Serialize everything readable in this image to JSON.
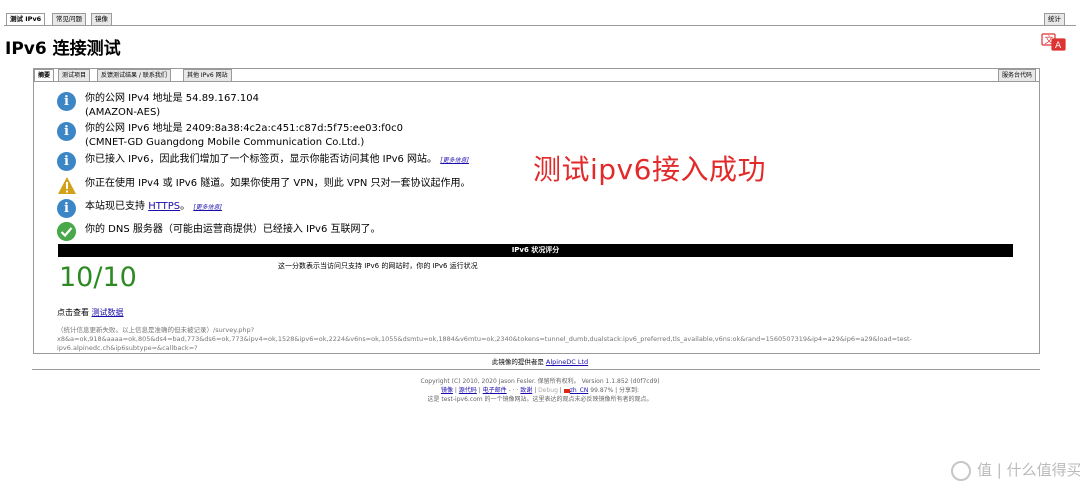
{
  "top_tabs": {
    "test": "测试 IPv6",
    "faq": "常见问题",
    "mirrors": "镜像",
    "stats": "统计"
  },
  "page_title": "IPv6 连接测试",
  "sub_tabs": {
    "summary": "摘要",
    "tests": "测试项目",
    "feedback": "反馈测试结果 / 联系我们",
    "other_sites": "其他 IPv6 网站",
    "helpdesk": "服务台代码"
  },
  "results": [
    {
      "line1": "你的公网 IPv4 地址是 54.89.167.104",
      "line2": "(AMAZON-AES)"
    },
    {
      "line1": "你的公网 IPv6 地址是 2409:8a38:4c2a:c451:c87d:5f75:ee03:f0c0",
      "line2": "(CMNET-GD Guangdong Mobile Communication Co.Ltd.)"
    },
    {
      "line1": "你已接入 IPv6，因此我们增加了一个标签页，显示你能否访问其他 IPv6 网站。",
      "more": "[更多信息]"
    },
    {
      "line1": "你正在使用 IPv4 或 IPv6 隧道。如果你使用了 VPN，则此 VPN 只对一套协议起作用。"
    },
    {
      "line1_pre": "本站现已支持 ",
      "link": "HTTPS",
      "line1_post": "。",
      "more": "[更多信息]"
    },
    {
      "line1": "你的 DNS 服务器（可能由运营商提供）已经接入 IPv6 互联网了。"
    }
  ],
  "overlay_text": "测试ipv6接入成功",
  "score": {
    "header": "IPv6 状况评分",
    "value": "10/10",
    "description": "这一分数表示当访问只支持 IPv6 的网站时，你的 IPv6 运行状况",
    "color": "#2d8a23"
  },
  "view_data": {
    "prefix": "点击查看 ",
    "link": "测试数据"
  },
  "stats_text_1": "（统计信息更新失败。以上信息是准确的但未被记录）/survey.php?",
  "stats_text_2": "x8&a=ok,918&aaaa=ok,805&ds4=bad,773&ds6=ok,773&ipv4=ok,1528&ipv6=ok,2224&v6ns=ok,1055&dsmtu=ok,1884&v6mtu=ok,2340&tokens=tunnel_dumb,dualstack:ipv6_preferred,tls_available,v6ns:ok&rand=1560507319&ip4=a29&ip6=a29&load=test-",
  "stats_text_3": "ipv6.alpinedc.ch&ip6subtype=&callback=?",
  "mirror": {
    "prefix": "此镜像的提供者是 ",
    "link": "AlpineDC Ltd"
  },
  "footer": {
    "copyright": "Copyright (C) 2010, 2020 Jason Fesler. 保留所有权利。 Version 1.1.852 (d0f7cd9)",
    "links": [
      "镜像",
      "源代码",
      "电子邮件",
      "致谢"
    ],
    "debug": "Debug",
    "lang": "zh_CN",
    "percent": "99.87%",
    "share": "分享到:",
    "note": "这是 test-ipv6.com 的一个镜像网站。这里表达的观点未必反映镜像所有者的观点。"
  },
  "watermark": "值 | 什么值得买",
  "colors": {
    "info": "#3d86c6",
    "warning": "#d4a017",
    "success": "#49a84a",
    "accent_red": "#e32a2a"
  }
}
